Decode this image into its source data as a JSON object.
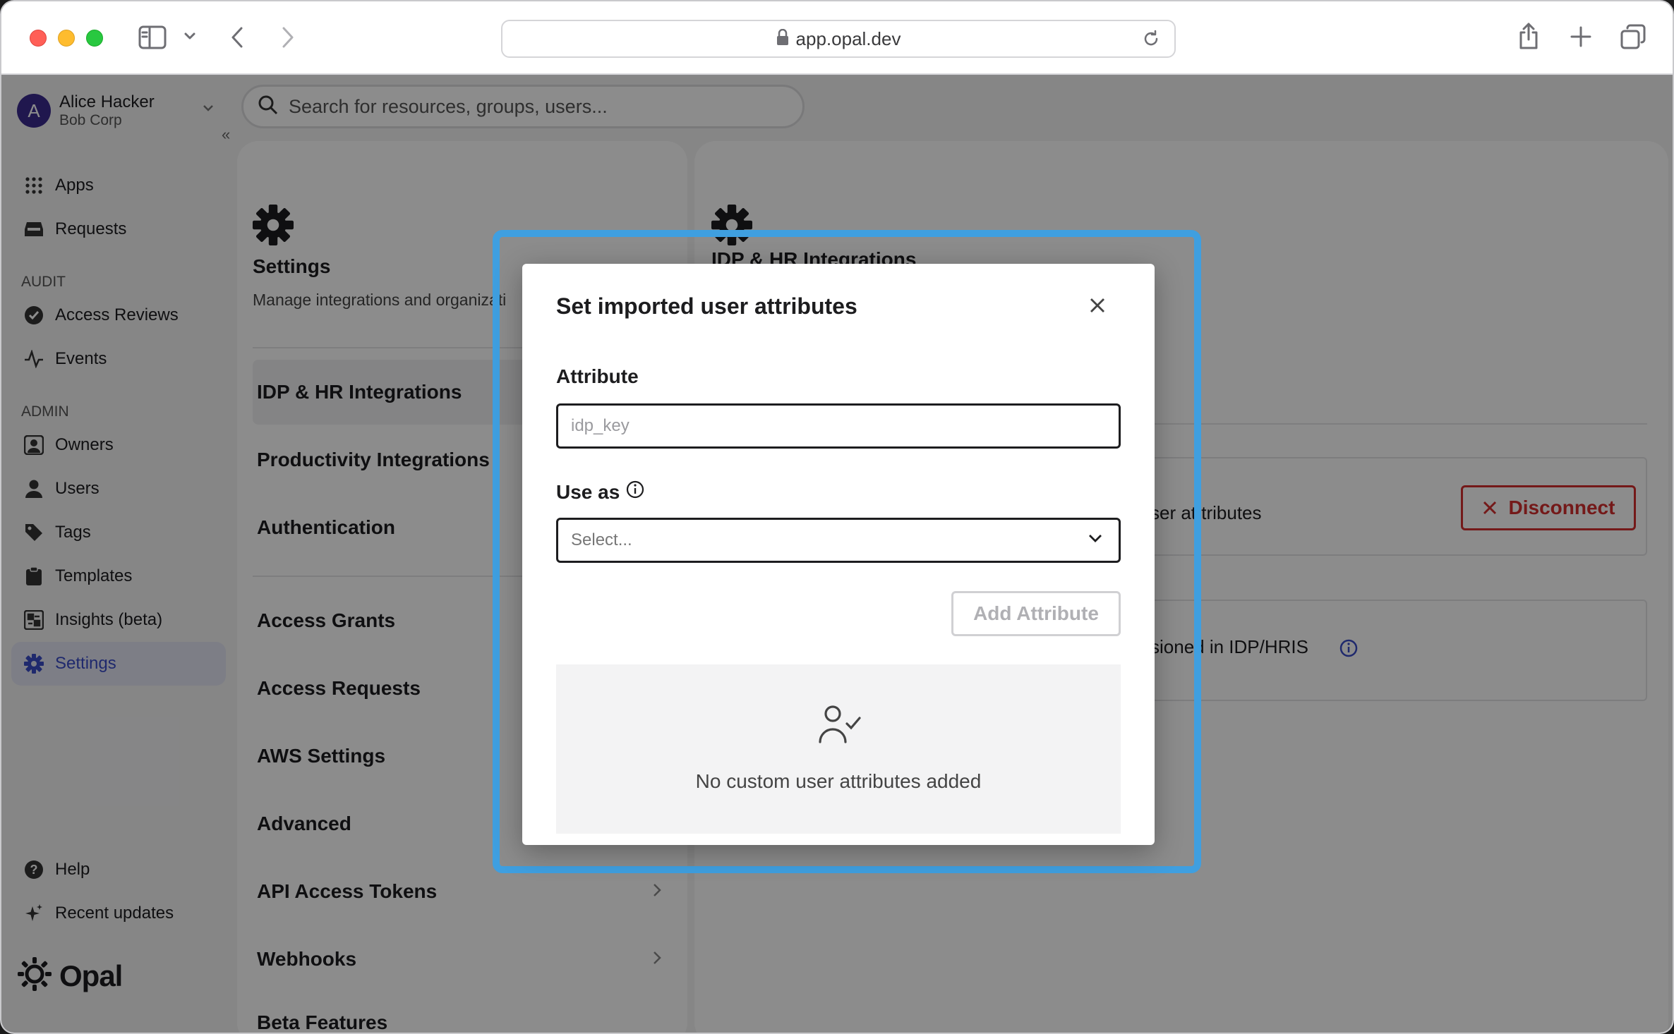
{
  "browser": {
    "url": "app.opal.dev"
  },
  "account": {
    "initial": "A",
    "name": "Alice Hacker",
    "org": "Bob Corp"
  },
  "search": {
    "placeholder": "Search for resources, groups, users..."
  },
  "sidebar": {
    "collapse_glyph": "«",
    "top_items": [
      {
        "label": "Apps",
        "icon": "grid-icon"
      },
      {
        "label": "Requests",
        "icon": "inbox-icon"
      }
    ],
    "audit_heading": "AUDIT",
    "audit_items": [
      {
        "label": "Access Reviews",
        "icon": "check-circle-icon"
      },
      {
        "label": "Events",
        "icon": "activity-icon"
      }
    ],
    "admin_heading": "ADMIN",
    "admin_items": [
      {
        "label": "Owners",
        "icon": "owner-icon"
      },
      {
        "label": "Users",
        "icon": "user-icon"
      },
      {
        "label": "Tags",
        "icon": "tag-icon"
      },
      {
        "label": "Templates",
        "icon": "clipboard-icon"
      },
      {
        "label": "Insights (beta)",
        "icon": "insights-icon"
      },
      {
        "label": "Settings",
        "icon": "gear-icon",
        "active": true
      }
    ],
    "bottom_items": [
      {
        "label": "Help",
        "icon": "help-icon"
      },
      {
        "label": "Recent updates",
        "icon": "sparkle-icon"
      }
    ],
    "brand": "Opal"
  },
  "settings_panel": {
    "title": "Settings",
    "subtitle": "Manage integrations and organizati",
    "group1": [
      "IDP & HR Integrations",
      "Productivity Integrations",
      "Authentication"
    ],
    "group2": [
      "Access Grants",
      "Access Requests",
      "AWS Settings",
      "Advanced",
      "API Access Tokens",
      "Webhooks",
      "Beta Features"
    ]
  },
  "detail_panel": {
    "title": "IDP & HR Integrations",
    "card1_text": "ser at tributes",
    "disconnect_label": "Disconnect",
    "card2_text": "sioned in IDP/HRIS"
  },
  "modal": {
    "title": "Set imported user attributes",
    "attribute_label": "Attribute",
    "attribute_placeholder": "idp_key",
    "use_as_label": "Use as",
    "use_as_placeholder": "Select...",
    "add_button": "Add Attribute",
    "empty_text": "No custom user attributes added"
  },
  "colors": {
    "accent": "#3a4cc7",
    "highlight": "#3f9fe0",
    "danger": "#d32f2f"
  }
}
